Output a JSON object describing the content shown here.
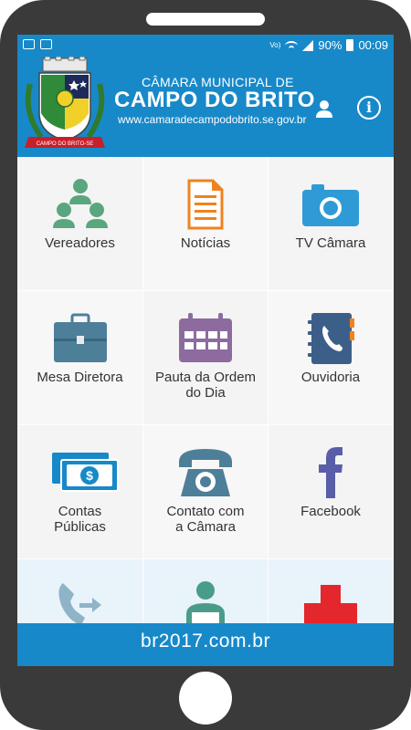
{
  "status_bar": {
    "network": "Vo)",
    "battery": "90%",
    "time": "00:09"
  },
  "header": {
    "subtitle": "CÂMARA MUNICIPAL DE",
    "title": "CAMPO DO BRITO",
    "website": "www.camaradecampodobrito.se.gov.br",
    "crest_ribbon": "CAMPO DO BRITO-SE"
  },
  "menu": [
    {
      "label": "Vereadores",
      "icon": "councilors-icon"
    },
    {
      "label": "Notícias",
      "icon": "news-document-icon"
    },
    {
      "label": "TV Câmara",
      "icon": "camera-icon"
    },
    {
      "label": "Mesa Diretora",
      "icon": "briefcase-icon"
    },
    {
      "label": "Pauta da Ordem do Dia",
      "icon": "calendar-icon"
    },
    {
      "label": "Ouvidoria",
      "icon": "phonebook-icon"
    },
    {
      "label": "Contas Públicas",
      "icon": "money-icon"
    },
    {
      "label": "Contato com a Câmara",
      "icon": "telephone-icon"
    },
    {
      "label": "Facebook",
      "icon": "facebook-icon"
    },
    {
      "label": "",
      "icon": "phone-transfer-icon"
    },
    {
      "label": "",
      "icon": "reader-icon"
    },
    {
      "label": "",
      "icon": "red-cross-icon"
    }
  ],
  "menu_rows": [
    [
      "Vereadores"
    ],
    [
      "Notícias"
    ],
    [
      "TV Câmara"
    ],
    [
      "Mesa Diretora"
    ],
    [
      "Pauta da Ordem",
      "do Dia"
    ],
    [
      "Ouvidoria"
    ],
    [
      "Contas",
      "Públicas"
    ],
    [
      "Contato com",
      "a Câmara"
    ],
    [
      "Facebook"
    ]
  ],
  "footer": {
    "text": "br2017.com.br"
  },
  "colors": {
    "primary": "#1789c9",
    "green": "#5aa67e",
    "orange": "#f0821e",
    "blue": "#2f9bd6",
    "slate": "#4d7f99",
    "purple": "#8e6b9f",
    "navy": "#3c5f8a",
    "facebook": "#5a5ea8",
    "red": "#e4262d"
  }
}
